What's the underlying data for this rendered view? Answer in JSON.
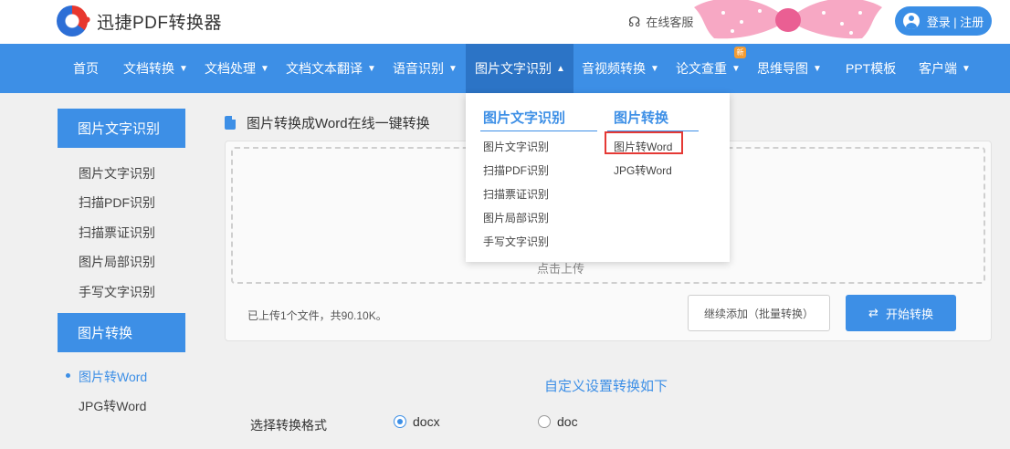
{
  "header": {
    "logo_text": "迅捷PDF转换器",
    "support_text": "在线客服",
    "login_label": "登录 | 注册"
  },
  "nav": {
    "items": [
      {
        "label": "首页",
        "caret": ""
      },
      {
        "label": "文档转换",
        "caret": "▼"
      },
      {
        "label": "文档处理",
        "caret": "▼"
      },
      {
        "label": "文档文本翻译",
        "caret": "▼"
      },
      {
        "label": "语音识别",
        "caret": "▼"
      },
      {
        "label": "图片文字识别",
        "caret": "▲"
      },
      {
        "label": "音视频转换",
        "caret": "▼"
      },
      {
        "label": "论文查重",
        "caret": "▼"
      },
      {
        "label": "思维导图",
        "caret": "▼"
      },
      {
        "label": "PPT模板",
        "caret": ""
      },
      {
        "label": "客户端",
        "caret": "▼"
      }
    ],
    "badge": "新"
  },
  "sidebar": {
    "group1_title": "图片文字识别",
    "group1_items": [
      "图片文字识别",
      "扫描PDF识别",
      "扫描票证识别",
      "图片局部识别",
      "手写文字识别"
    ],
    "group2_title": "图片转换",
    "group2_items": [
      "图片转Word",
      "JPG转Word"
    ]
  },
  "main": {
    "title": "图片转换成Word在线一键转换",
    "drop_hint": "点击上传",
    "upload_status": "已上传1个文件，共90.10K。",
    "continue_label": "继续添加（批量转换）",
    "start_label": "开始转换",
    "settings_title": "自定义设置转换如下",
    "format_label": "选择转换格式",
    "format_options": [
      "docx",
      "doc"
    ]
  },
  "dropdown": {
    "col1_title": "图片文字识别",
    "col1_items": [
      "图片文字识别",
      "扫描PDF识别",
      "扫描票证识别",
      "图片局部识别",
      "手写文字识别"
    ],
    "col2_title": "图片转换",
    "col2_items": [
      "图片转Word",
      "JPG转Word"
    ]
  },
  "colors": {
    "primary": "#3d8fe6",
    "active_nav": "#2c74c6",
    "highlight_box": "#e53935",
    "badge": "#f39c34"
  }
}
